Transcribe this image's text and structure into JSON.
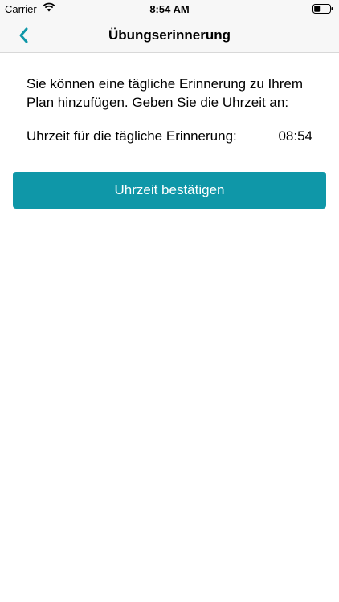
{
  "status_bar": {
    "carrier": "Carrier",
    "time": "8:54 AM"
  },
  "nav": {
    "title": "Übungserinnerung",
    "back_icon": "chevron-left-icon"
  },
  "reminder": {
    "intro": "Sie können eine tägliche Erinnerung zu Ihrem Plan hinzufügen. Geben Sie die Uhrzeit an:",
    "time_label": "Uhrzeit für die tägliche Erinnerung:",
    "time_value": "08:54"
  },
  "confirm_button": {
    "label": "Uhrzeit bestätigen"
  },
  "colors": {
    "accent": "#0f97a8",
    "nav_background": "#f7f7f7"
  }
}
